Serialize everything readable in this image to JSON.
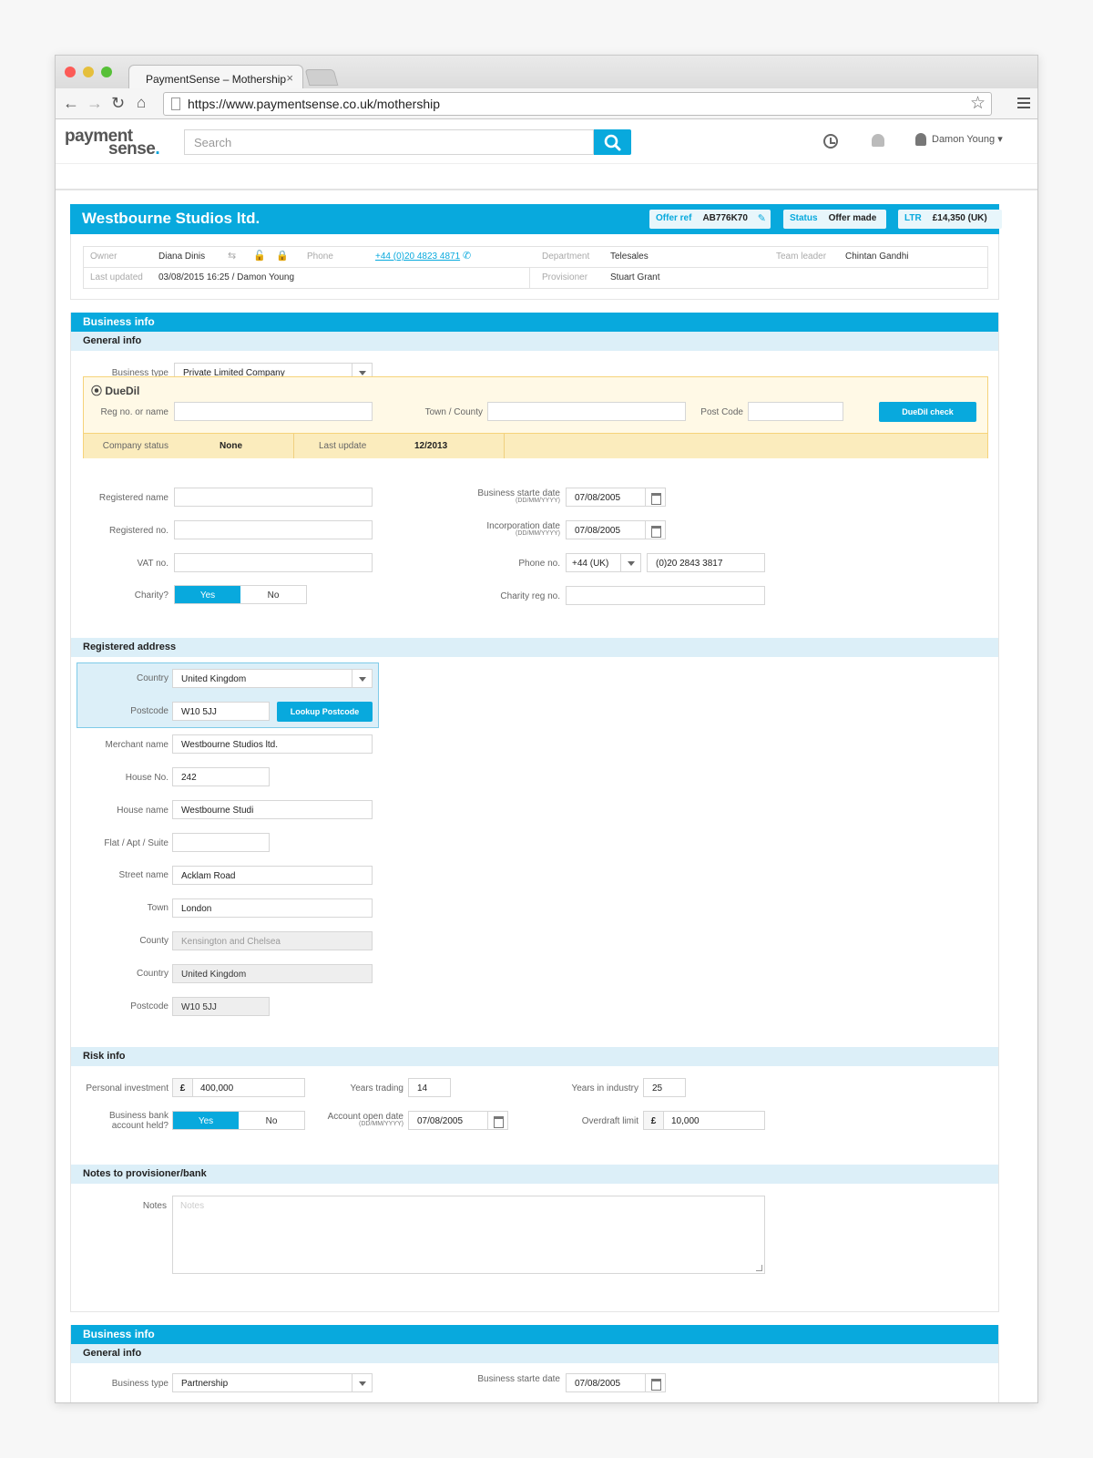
{
  "browser": {
    "tab_title": "PaymentSense – Mothership",
    "tab_close": "×",
    "url": "https://www.paymentsense.co.uk/mothership",
    "traffic_colors": [
      "#fc5b57",
      "#e5bf3c",
      "#57c038"
    ]
  },
  "app": {
    "logo_line1": "payment",
    "logo_line2": "sense",
    "logo_dot": ".",
    "search_placeholder": "Search",
    "user_name": "Damon Young",
    "accent": "#08a9dd"
  },
  "record": {
    "title": "Westbourne Studios ltd.",
    "offer_ref_label": "Offer ref",
    "offer_ref": "AB776K70",
    "status_label": "Status",
    "status": "Offer made",
    "ltr_label": "LTR",
    "ltr": "£14,350 (UK)",
    "owner_label": "Owner",
    "owner": "Diana Dinis",
    "phone_label": "Phone",
    "phone": "+44 (0)20 4823 4871",
    "department_label": "Department",
    "department": "Telesales",
    "team_leader_label": "Team leader",
    "team_leader": "Chintan Gandhi",
    "last_updated_label": "Last updated",
    "last_updated": "03/08/2015 16:25 / Damon Young",
    "provisioner_label": "Provisioner",
    "provisioner": "Stuart Grant"
  },
  "business_info": {
    "header": "Business info",
    "general_info": "General info",
    "business_type_label": "Business type",
    "business_type": "Private Limited Company",
    "duedil": {
      "brand": "DueDil",
      "reg_label": "Reg no. or name",
      "town_label": "Town / County",
      "postcode_label": "Post Code",
      "check_button": "DueDil check",
      "company_status_label": "Company status",
      "company_status": "None",
      "last_update_label": "Last update",
      "last_update": "12/2013"
    },
    "registered_name_label": "Registered name",
    "registered_no_label": "Registered no.",
    "vat_label": "VAT no.",
    "charity_label": "Charity?",
    "yes": "Yes",
    "no": "No",
    "start_date_label": "Business starte date",
    "date_format": "(DD/MM/YYYY)",
    "start_date": "07/08/2005",
    "incorporation_label": "Incorporation date",
    "incorporation_date": "07/08/2005",
    "phone_no_label": "Phone no.",
    "phone_code": "+44 (UK)",
    "phone_no": "(0)20 2843 3817",
    "charity_reg_label": "Charity reg no."
  },
  "registered_address": {
    "header": "Registered address",
    "country_label": "Country",
    "country": "United Kingdom",
    "postcode_label": "Postcode",
    "postcode": "W10 5JJ",
    "lookup_button": "Lookup Postcode",
    "merchant_name_label": "Merchant name",
    "merchant_name": "Westbourne Studios ltd.",
    "house_no_label": "House No.",
    "house_no": "242",
    "house_name_label": "House name",
    "house_name": "Westbourne Studi",
    "flat_label": "Flat / Apt / Suite",
    "street_label": "Street name",
    "street": "Acklam Road",
    "town_label": "Town",
    "town": "London",
    "county_label": "County",
    "county": "Kensington and Chelsea",
    "country2_label": "Country",
    "country2": "United Kingdom",
    "postcode2_label": "Postcode",
    "postcode2": "W10 5JJ"
  },
  "risk_info": {
    "header": "Risk info",
    "personal_investment_label": "Personal investment",
    "currency": "£",
    "personal_investment": "400,000",
    "years_trading_label": "Years trading",
    "years_trading": "14",
    "years_industry_label": "Years in industry",
    "years_industry": "25",
    "bank_account_label1": "Business bank",
    "bank_account_label2": "account held?",
    "yes": "Yes",
    "no": "No",
    "account_open_label": "Account open date",
    "date_format": "(DD/MM/YYYY)",
    "account_open_date": "07/08/2005",
    "overdraft_label": "Overdraft limit",
    "overdraft": "10,000"
  },
  "notes": {
    "header": "Notes to provisioner/bank",
    "notes_label": "Notes",
    "notes_placeholder": "Notes"
  },
  "business_info_2": {
    "header": "Business info",
    "general_info": "General info",
    "business_type_label": "Business type",
    "business_type": "Partnership",
    "start_date_label": "Business starte date",
    "start_date": "07/08/2005"
  }
}
